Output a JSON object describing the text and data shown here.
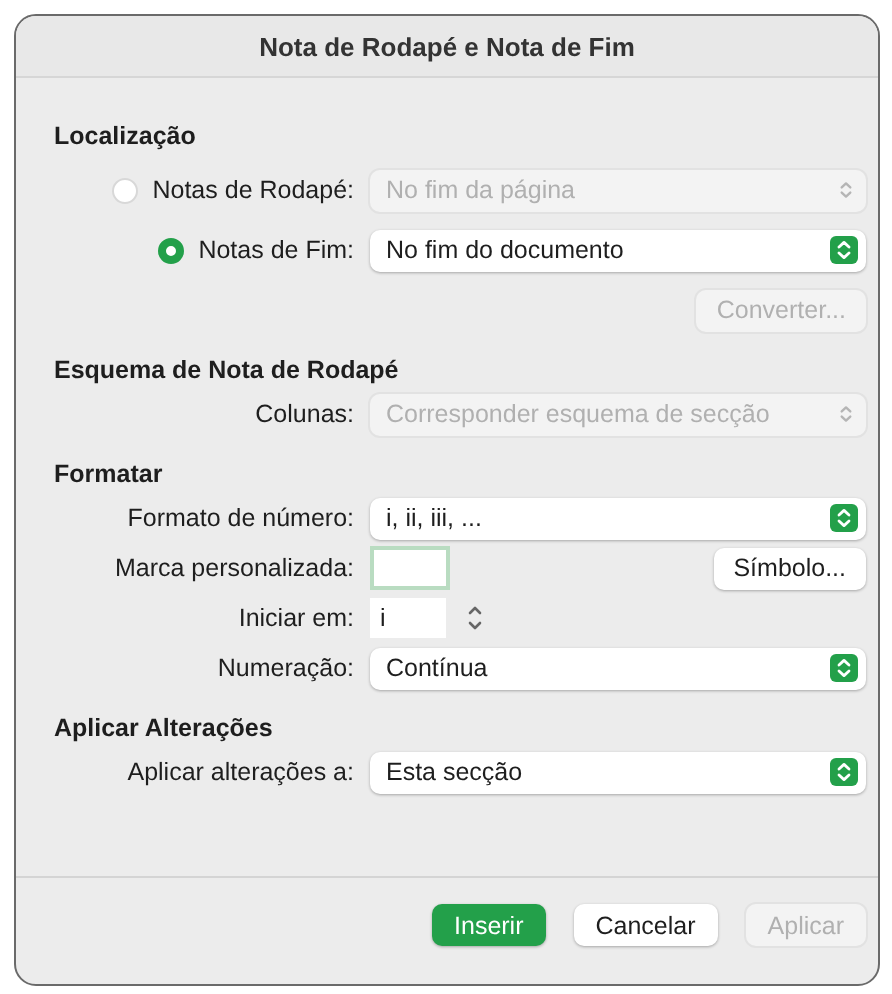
{
  "window": {
    "title": "Nota de Rodapé e Nota de Fim"
  },
  "sections": [
    {
      "heading": "Localização",
      "rows": [
        {
          "kind": "radio",
          "label": "Notas de Rodapé:",
          "selected": false,
          "value": "No fim da página",
          "disabled": true
        },
        {
          "kind": "radio",
          "label": "Notas de Fim:",
          "selected": true,
          "value": "No fim do documento",
          "disabled": false
        },
        {
          "kind": "button",
          "label": "Converter...",
          "disabled": true
        }
      ]
    },
    {
      "heading": "Esquema de Nota de Rodapé",
      "rows": [
        {
          "kind": "popup",
          "label": "Colunas:",
          "value": "Corresponder esquema de secção",
          "disabled": true
        }
      ]
    },
    {
      "heading": "Formatar",
      "rows": [
        {
          "kind": "popup",
          "label": "Formato de número:",
          "value": "i, ii, iii, ...",
          "disabled": false
        },
        {
          "kind": "field",
          "label": "Marca personalizada:",
          "button": "Símbolo..."
        },
        {
          "kind": "stepper",
          "label": "Iniciar em:",
          "value": "i"
        },
        {
          "kind": "popup",
          "label": "Numeração:",
          "value": "Contínua",
          "disabled": false
        }
      ]
    },
    {
      "heading": "Aplicar Alterações",
      "rows": [
        {
          "kind": "popup",
          "label": "Aplicar alterações a:",
          "value": "Esta secção",
          "disabled": false
        }
      ]
    }
  ],
  "buttons": [
    {
      "label": "Inserir",
      "kind": "default",
      "disabled": false
    },
    {
      "label": "Cancelar",
      "kind": "normal",
      "disabled": false
    },
    {
      "label": "Aplicar",
      "kind": "normal",
      "disabled": true
    }
  ]
}
